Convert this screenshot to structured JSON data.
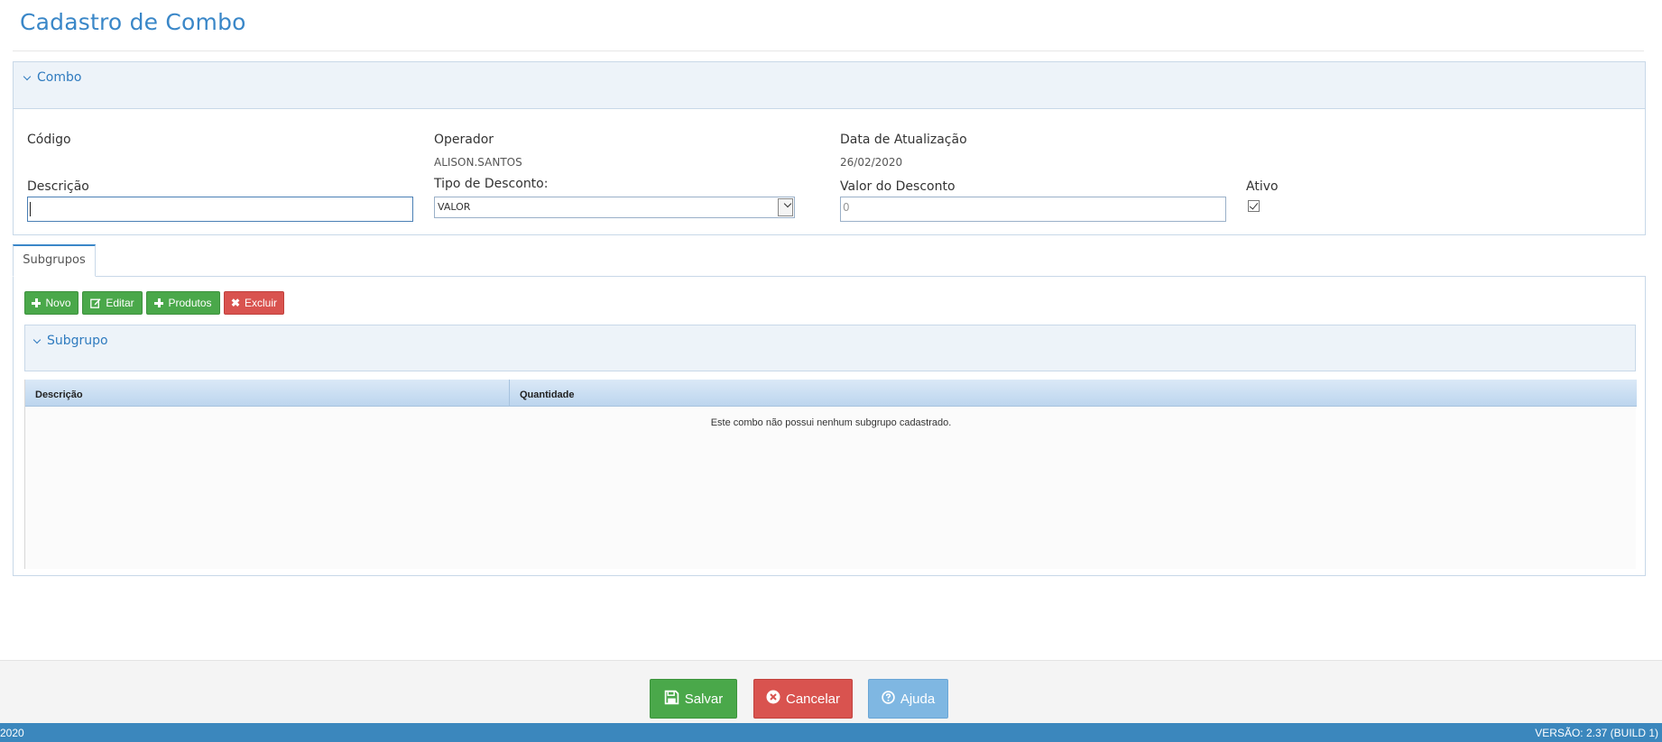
{
  "page": {
    "title": "Cadastro de Combo"
  },
  "combo_panel": {
    "header": "Combo",
    "fields": {
      "codigo_label": "Código",
      "operador_label": "Operador",
      "operador_value": "ALISON.SANTOS",
      "data_label": "Data de Atualização",
      "data_value": "26/02/2020",
      "descricao_label": "Descrição",
      "descricao_value": "",
      "tipo_desconto_label": "Tipo de Desconto:",
      "tipo_desconto_value": "VALOR",
      "valor_desconto_label": "Valor do Desconto",
      "valor_desconto_value": "0",
      "ativo_label": "Ativo",
      "ativo_checked": true
    }
  },
  "tabs": [
    {
      "label": "Subgrupos",
      "active": true
    }
  ],
  "subgrupos_panel": {
    "buttons": {
      "novo": "Novo",
      "editar": "Editar",
      "produtos": "Produtos",
      "excluir": "Excluir"
    },
    "section_header": "Subgrupo",
    "table": {
      "columns": [
        "Descrição",
        "Quantidade"
      ],
      "rows": [],
      "empty_message": "Este combo não possui nenhum subgrupo cadastrado."
    }
  },
  "footer": {
    "salvar": "Salvar",
    "cancelar": "Cancelar",
    "ajuda": "Ajuda"
  },
  "status_bar": {
    "left_text": "2020",
    "version_text": "VERSÃO: 2.37 (BUILD 1)"
  },
  "colors": {
    "accent": "#3a87c8",
    "success": "#4aa84a",
    "danger": "#d9534f",
    "info": "#7fb7e2",
    "status_bar": "#3b87bd"
  },
  "icons": {
    "chevron": "chevron-down-icon",
    "plus": "plus-icon",
    "edit": "edit-icon",
    "times": "times-icon",
    "save": "floppy-disk-icon",
    "cancel": "times-circle-icon",
    "help": "question-circle-icon",
    "dropdown": "chevron-down-icon",
    "check": "check-icon"
  }
}
